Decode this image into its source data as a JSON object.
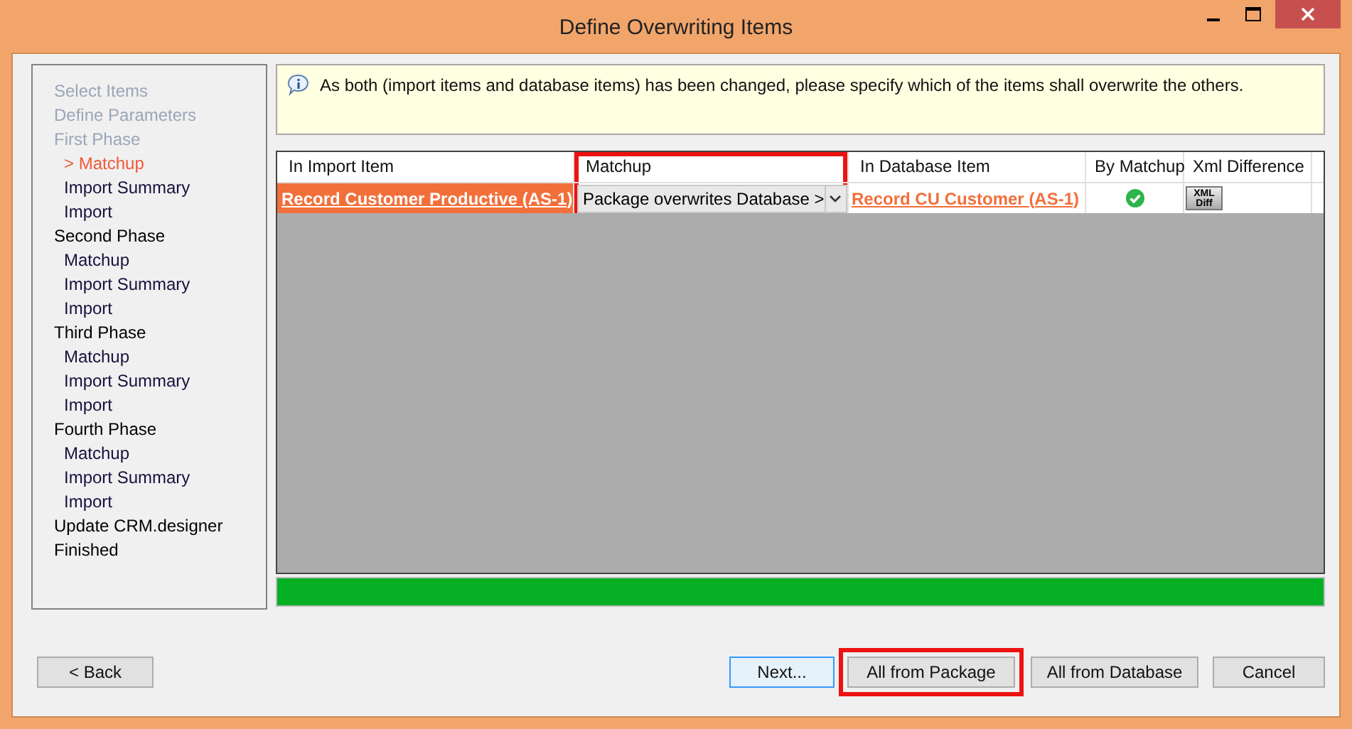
{
  "window": {
    "title": "Define Overwriting Items"
  },
  "steps": [
    {
      "label": "Select Items",
      "done": true,
      "selected": false
    },
    {
      "label": "Define Parameters",
      "done": true,
      "selected": false
    },
    {
      "label": "First Phase",
      "done": true,
      "selected": false,
      "children": [
        {
          "label": "> Matchup",
          "done": false,
          "selected": true
        },
        {
          "label": "Import Summary",
          "done": false,
          "selected": false
        },
        {
          "label": "Import",
          "done": false,
          "selected": false
        }
      ]
    },
    {
      "label": "Second Phase",
      "done": false,
      "selected": false,
      "children": [
        {
          "label": "Matchup",
          "done": false,
          "selected": false
        },
        {
          "label": "Import Summary",
          "done": false,
          "selected": false
        },
        {
          "label": "Import",
          "done": false,
          "selected": false
        }
      ]
    },
    {
      "label": "Third Phase",
      "done": false,
      "selected": false,
      "children": [
        {
          "label": "Matchup",
          "done": false,
          "selected": false
        },
        {
          "label": "Import Summary",
          "done": false,
          "selected": false
        },
        {
          "label": "Import",
          "done": false,
          "selected": false
        }
      ]
    },
    {
      "label": "Fourth Phase",
      "done": false,
      "selected": false,
      "children": [
        {
          "label": "Matchup",
          "done": false,
          "selected": false
        },
        {
          "label": "Import Summary",
          "done": false,
          "selected": false
        },
        {
          "label": "Import",
          "done": false,
          "selected": false
        }
      ]
    },
    {
      "label": "Update CRM.designer",
      "done": false,
      "selected": false
    },
    {
      "label": "Finished",
      "done": false,
      "selected": false
    }
  ],
  "info": {
    "message": "As both (import items and database items) has been changed, please specify which of the items shall overwrite the others."
  },
  "table": {
    "columns": [
      {
        "label": "In Import Item",
        "highlighted": false
      },
      {
        "label": "Matchup",
        "highlighted": true
      },
      {
        "label": "In Database Item",
        "highlighted": false
      },
      {
        "label": "By Matchup",
        "highlighted": false
      },
      {
        "label": "Xml Difference",
        "highlighted": false
      }
    ],
    "rows": [
      {
        "import_item": "Record Customer Productive (AS-1)",
        "matchup": "Package overwrites Database >",
        "database_item": "Record CU  Customer (AS-1)",
        "by_matchup": true,
        "diff_button": [
          "XML",
          "Diff"
        ]
      }
    ]
  },
  "progress": {
    "level": 1
  },
  "buttons": [
    {
      "label": "< Back",
      "focused": false,
      "highlighted": false
    },
    {
      "label": "Next...",
      "focused": true,
      "highlighted": false
    },
    {
      "label": "All from Package",
      "focused": false,
      "highlighted": true
    },
    {
      "label": "All from Database",
      "focused": false,
      "highlighted": false
    },
    {
      "label": "Cancel",
      "focused": false,
      "highlighted": false
    }
  ]
}
